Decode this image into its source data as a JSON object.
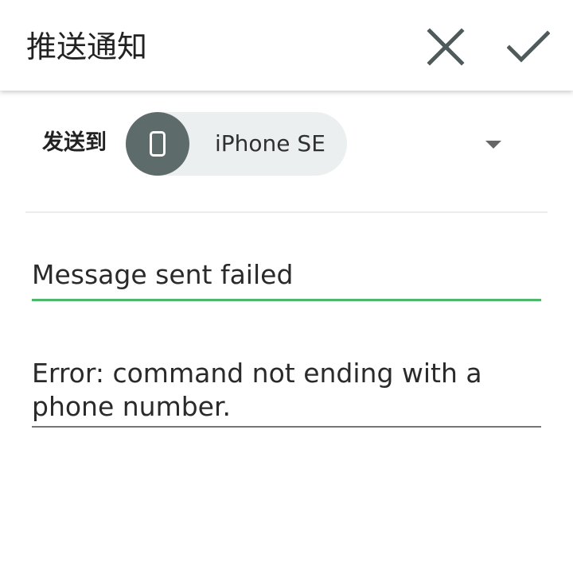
{
  "appbar": {
    "title": "推送通知",
    "close_icon": "close-icon",
    "done_icon": "check-icon"
  },
  "send_to": {
    "label": "发送到",
    "device_icon": "smartphone-icon",
    "device_name": "iPhone SE",
    "dropdown_icon": "dropdown-arrow-icon"
  },
  "form": {
    "title_value": "Message sent failed",
    "message_value": "Error: command not ending with a phone number."
  },
  "colors": {
    "accent": "#4cb86a",
    "chip_bg": "#ebeff0",
    "avatar_bg": "#5d6b6b",
    "icon": "#4f5b5b"
  }
}
